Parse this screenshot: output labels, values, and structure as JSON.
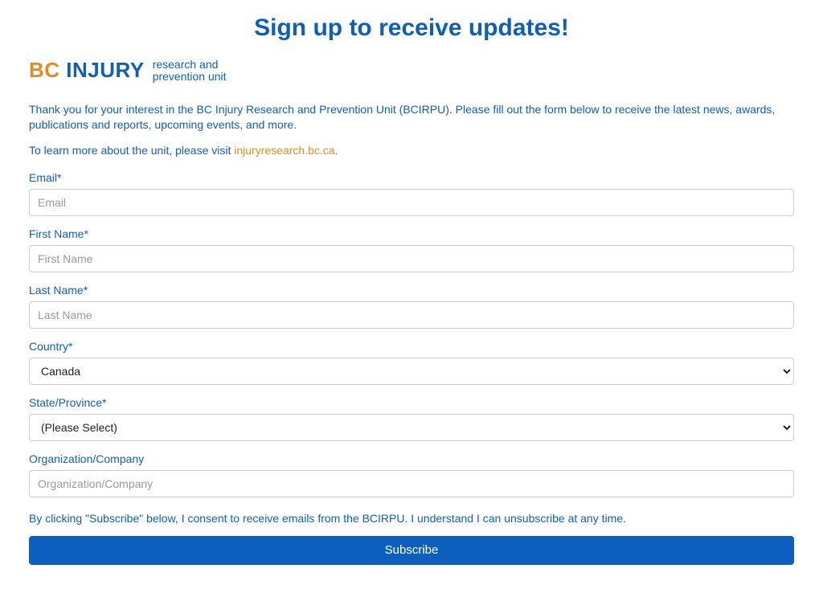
{
  "page": {
    "title": "Sign up to receive updates!"
  },
  "logo": {
    "bc": "BC",
    "injury": "INJURY",
    "line1": "research and",
    "line2": "prevention unit"
  },
  "intro": "Thank you for your interest in the BC Injury Research and Prevention Unit (BCIRPU). Please fill out the form below to receive the latest news, awards, publications and reports, upcoming events, and more.",
  "learn_more": {
    "prefix": "To learn more about the unit, please visit ",
    "link_text": "injuryresearch.bc.ca",
    "suffix": "."
  },
  "form": {
    "email": {
      "label": "Email*",
      "placeholder": "Email",
      "value": ""
    },
    "first_name": {
      "label": "First Name*",
      "placeholder": "First Name",
      "value": ""
    },
    "last_name": {
      "label": "Last Name*",
      "placeholder": "Last Name",
      "value": ""
    },
    "country": {
      "label": "Country*",
      "selected": "Canada"
    },
    "state": {
      "label": "State/Province*",
      "selected": "(Please Select)"
    },
    "organization": {
      "label": "Organization/Company",
      "placeholder": "Organization/Company",
      "value": ""
    },
    "consent": "By clicking \"Subscribe\" below, I consent to receive emails from the BCIRPU. I understand I can unsubscribe at any time.",
    "subscribe_label": "Subscribe"
  }
}
